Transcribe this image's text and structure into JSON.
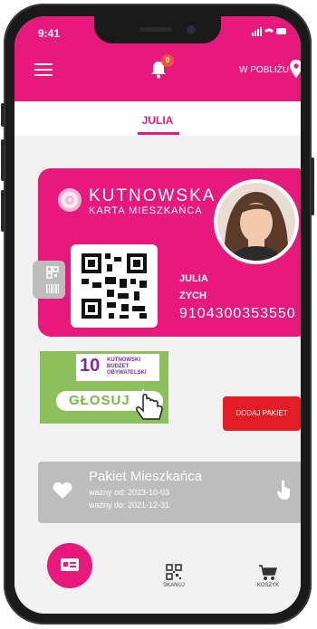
{
  "status_bar": {
    "time": "9:41",
    "icons": "signal-wifi-battery"
  },
  "app_bar": {
    "notification_count": "0",
    "nearby_label": "W POBLIŻU",
    "menu_icon": "hamburger-menu-icon",
    "bell_icon": "bell-icon",
    "location_icon": "location-pin-icon"
  },
  "tabs": {
    "active": "JULIA"
  },
  "card": {
    "brand_line1": "KUTNOWSKA",
    "brand_line2": "KARTA MIESZKAŃCA",
    "first_name": "JULIA",
    "last_name": "ZYCH",
    "number": "9104300353550"
  },
  "vote_banner": {
    "badge": "10",
    "logo_line1": "KUTNOWSKI",
    "logo_line2": "BUDŻET",
    "logo_line3": "OBYWATELSKI",
    "button": "GŁOSUJ"
  },
  "add_package_button": "DODAJ PAKIET",
  "package": {
    "title": "Pakiet Mieszkańca",
    "valid_from": "ważny od: 2023-10-03",
    "valid_to": "ważny do: 2021-12-31"
  },
  "bottom_nav": {
    "scan_label": "SKANUJ",
    "cart_label": "KOSZYK"
  },
  "colors": {
    "brand": "#e8197d",
    "add_button": "#e21d25",
    "vote_green": "#8dc05a",
    "package_gray": "#bdbdbd"
  }
}
